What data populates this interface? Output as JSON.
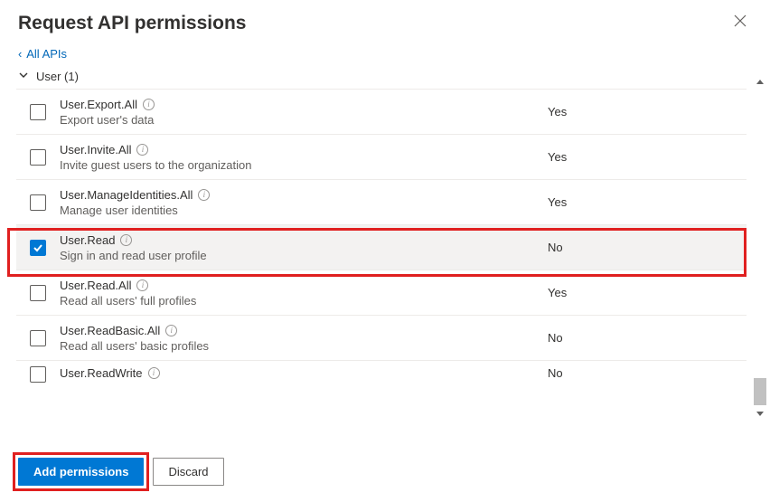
{
  "header": {
    "title": "Request API permissions",
    "back_link": "All APIs"
  },
  "group": {
    "label": "User (1)"
  },
  "columns": {
    "admin": {
      "yes": "Yes",
      "no": "No"
    }
  },
  "permissions": [
    {
      "name": "User.Export.All",
      "desc": "Export user's data",
      "admin": "Yes",
      "checked": false,
      "selected": false
    },
    {
      "name": "User.Invite.All",
      "desc": "Invite guest users to the organization",
      "admin": "Yes",
      "checked": false,
      "selected": false
    },
    {
      "name": "User.ManageIdentities.All",
      "desc": "Manage user identities",
      "admin": "Yes",
      "checked": false,
      "selected": false
    },
    {
      "name": "User.Read",
      "desc": "Sign in and read user profile",
      "admin": "No",
      "checked": true,
      "selected": true
    },
    {
      "name": "User.Read.All",
      "desc": "Read all users' full profiles",
      "admin": "Yes",
      "checked": false,
      "selected": false
    },
    {
      "name": "User.ReadBasic.All",
      "desc": "Read all users' basic profiles",
      "admin": "No",
      "checked": false,
      "selected": false
    },
    {
      "name": "User.ReadWrite",
      "desc": "",
      "admin": "No",
      "checked": false,
      "selected": false
    }
  ],
  "footer": {
    "add_label": "Add permissions",
    "discard_label": "Discard"
  }
}
